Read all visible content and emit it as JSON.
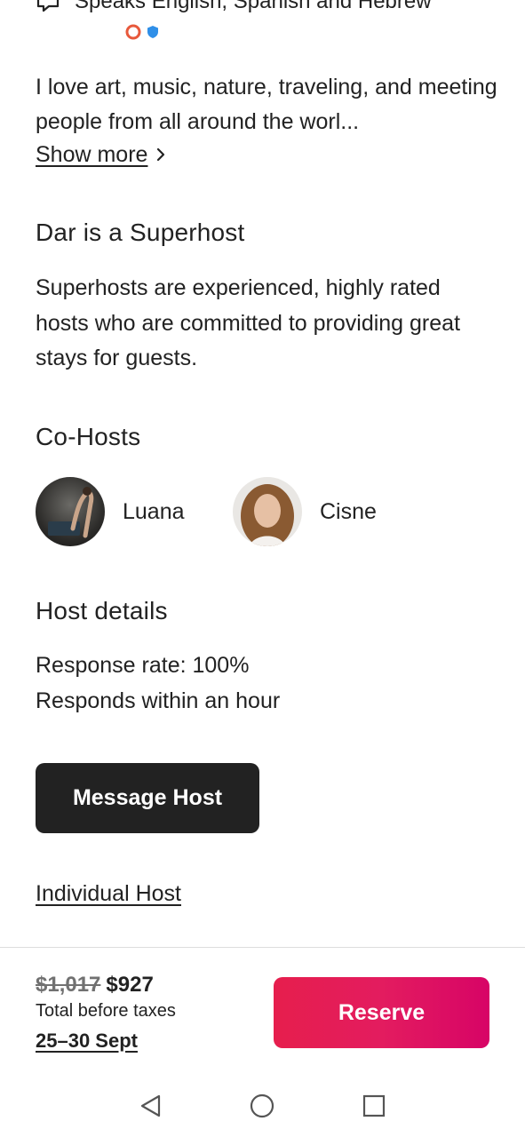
{
  "host": {
    "speaks": "Speaks English, Spanish and Hebrew",
    "bio": "I love art, music, nature, traveling, and meeting people from all around the worl...",
    "show_more": "Show more"
  },
  "superhost": {
    "heading": "Dar is a Superhost",
    "description": "Superhosts are experienced, highly rated hosts who are committed to providing great stays for guests."
  },
  "cohosts": {
    "heading": "Co-Hosts",
    "items": [
      {
        "name": "Luana"
      },
      {
        "name": "Cisne"
      }
    ]
  },
  "host_details": {
    "heading": "Host details",
    "response_rate": "Response rate: 100%",
    "response_time": "Responds within an hour",
    "message_button": "Message Host",
    "individual_host": "Individual Host"
  },
  "booking": {
    "old_price": "$1,017",
    "price": "$927",
    "total_label": "Total before taxes",
    "dates": "25–30 Sept",
    "reserve_button": "Reserve"
  },
  "colors": {
    "accent": "#e31c5f",
    "text": "#222222",
    "button_dark": "#222222"
  },
  "icons": {
    "speaks": "speech-bubble-icon",
    "show_more": "chevron-right-icon",
    "nav_back": "triangle-back-icon",
    "nav_home": "circle-home-icon",
    "nav_recents": "square-recents-icon"
  }
}
